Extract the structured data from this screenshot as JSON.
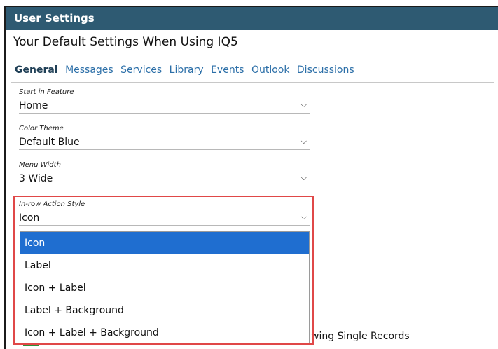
{
  "window": {
    "title": "User Settings"
  },
  "page": {
    "heading": "Your Default Settings When Using IQ5"
  },
  "tabs": [
    {
      "label": "General",
      "active": true
    },
    {
      "label": "Messages",
      "active": false
    },
    {
      "label": "Services",
      "active": false
    },
    {
      "label": "Library",
      "active": false
    },
    {
      "label": "Events",
      "active": false
    },
    {
      "label": "Outlook",
      "active": false
    },
    {
      "label": "Discussions",
      "active": false
    }
  ],
  "settings": {
    "start_feature": {
      "label": "Start in Feature",
      "value": "Home"
    },
    "color_theme": {
      "label": "Color Theme",
      "value": "Default Blue"
    },
    "menu_width": {
      "label": "Menu Width",
      "value": "3 Wide"
    },
    "inrow_action_style": {
      "label": "In-row Action Style",
      "value": "Icon",
      "options": [
        "Icon",
        "Label",
        "Icon + Label",
        "Label + Background",
        "Icon + Label + Background"
      ]
    }
  },
  "background_text": "wing Single Records",
  "colors": {
    "titlebar": "#2e5a72",
    "accent_selected": "#1f6ed0",
    "tab_link": "#2c6fa8",
    "highlight": "#e04848"
  },
  "icons": {
    "chevron": "chevron-down-icon"
  }
}
